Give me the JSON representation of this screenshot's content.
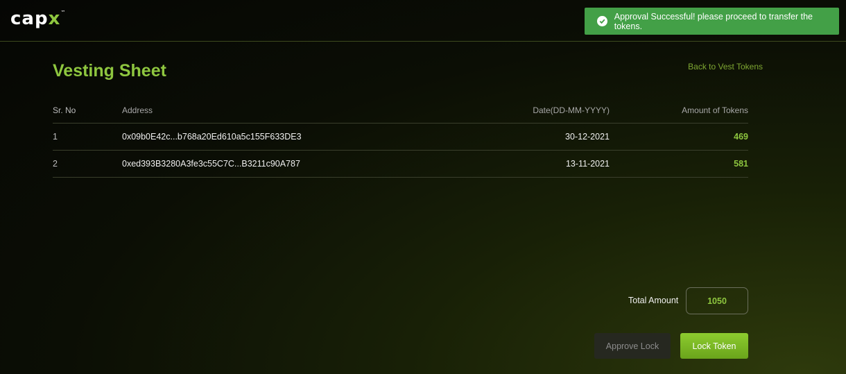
{
  "header": {
    "logo_main": "cap",
    "logo_accent": "x",
    "logo_tm": "™"
  },
  "toast": {
    "message": "Approval Successful! please proceed to transfer the tokens.",
    "icon": "check-circle-icon",
    "color": "#43a047"
  },
  "page": {
    "title": "Vesting Sheet",
    "back_link": "Back to Vest Tokens"
  },
  "table": {
    "headers": {
      "sr": "Sr. No",
      "address": "Address",
      "date": "Date(DD-MM-YYYY)",
      "amount": "Amount of Tokens"
    },
    "rows": [
      {
        "sr": "1",
        "address": "0x09b0E42c...b768a20Ed610a5c155F633DE3",
        "date": "30-12-2021",
        "amount": "469"
      },
      {
        "sr": "2",
        "address": "0xed393B3280A3fe3c55C7C...B3211c90A787",
        "date": "13-11-2021",
        "amount": "581"
      }
    ]
  },
  "total": {
    "label": "Total Amount",
    "value": "1050"
  },
  "buttons": {
    "approve_lock": "Approve Lock",
    "lock_token": "Lock Token"
  },
  "colors": {
    "accent": "#8ec63f",
    "background": "#0b0e05"
  }
}
